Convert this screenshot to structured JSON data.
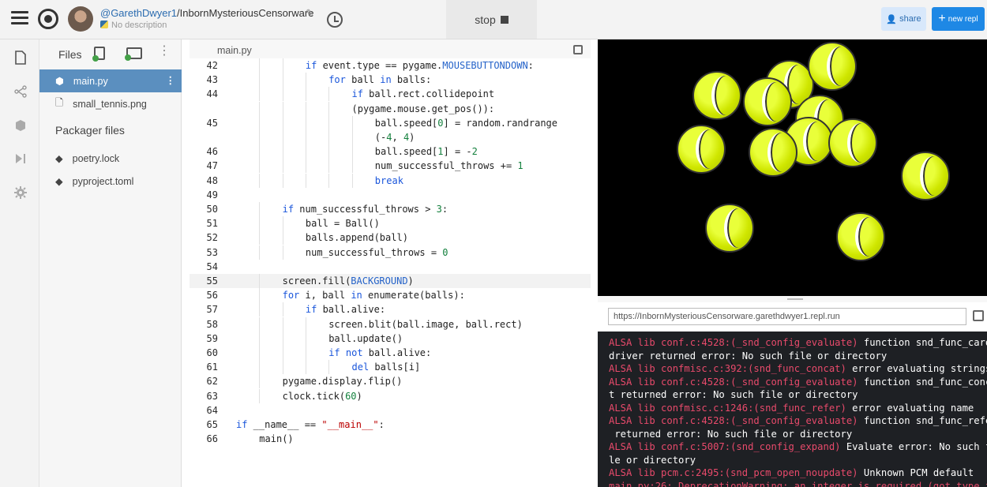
{
  "header": {
    "username": "@GarethDwyer1",
    "repl_name": "/InbornMysteriousCensorware",
    "description": "No description",
    "stop_label": "stop",
    "share_label": "share",
    "new_repl_label": "new repl"
  },
  "files_panel": {
    "title": "Files",
    "files": [
      {
        "name": "main.py",
        "icon": "python-file-icon",
        "active": true
      },
      {
        "name": "small_tennis.png",
        "icon": "file-icon",
        "active": false
      }
    ],
    "packager_title": "Packager files",
    "packager_files": [
      {
        "name": "poetry.lock",
        "icon": "package-icon"
      },
      {
        "name": "pyproject.toml",
        "icon": "package-icon"
      }
    ]
  },
  "editor": {
    "tab": "main.py",
    "current_line": 55,
    "lines": [
      {
        "n": "42",
        "indent": 3,
        "html": "if event.type == pygame.MOUSEBUTTONDOWN:"
      },
      {
        "n": "43",
        "indent": 4,
        "html": "for ball in balls:"
      },
      {
        "n": "44",
        "indent": 5,
        "html": "if ball.rect.collidepoint"
      },
      {
        "n": "",
        "indent": 5,
        "html": "(pygame.mouse.get_pos()):"
      },
      {
        "n": "45",
        "indent": 6,
        "html": "ball.speed[0] = random.randrange"
      },
      {
        "n": "",
        "indent": 6,
        "html": "(-4, 4)"
      },
      {
        "n": "46",
        "indent": 6,
        "html": "ball.speed[1] = -2"
      },
      {
        "n": "47",
        "indent": 6,
        "html": "num_successful_throws += 1"
      },
      {
        "n": "48",
        "indent": 6,
        "html": "break"
      },
      {
        "n": "49",
        "indent": 0,
        "html": ""
      },
      {
        "n": "50",
        "indent": 2,
        "html": "if num_successful_throws > 3:"
      },
      {
        "n": "51",
        "indent": 3,
        "html": "ball = Ball()"
      },
      {
        "n": "52",
        "indent": 3,
        "html": "balls.append(ball)"
      },
      {
        "n": "53",
        "indent": 3,
        "html": "num_successful_throws = 0"
      },
      {
        "n": "54",
        "indent": 0,
        "html": ""
      },
      {
        "n": "55",
        "indent": 2,
        "html": "screen.fill(BACKGROUND)"
      },
      {
        "n": "56",
        "indent": 2,
        "html": "for i, ball in enumerate(balls):"
      },
      {
        "n": "57",
        "indent": 3,
        "html": "if ball.alive:"
      },
      {
        "n": "58",
        "indent": 4,
        "html": "screen.blit(ball.image, ball.rect)"
      },
      {
        "n": "59",
        "indent": 4,
        "html": "ball.update()"
      },
      {
        "n": "60",
        "indent": 4,
        "html": "if not ball.alive:"
      },
      {
        "n": "61",
        "indent": 5,
        "html": "del balls[i]"
      },
      {
        "n": "62",
        "indent": 2,
        "html": "pygame.display.flip()"
      },
      {
        "n": "63",
        "indent": 2,
        "html": "clock.tick(60)"
      },
      {
        "n": "64",
        "indent": 0,
        "html": ""
      },
      {
        "n": "65",
        "indent": 0,
        "html": "if __name__ == \"__main__\":"
      },
      {
        "n": "66",
        "indent": 1,
        "html": "main()"
      }
    ]
  },
  "output": {
    "url": "https://InbornMysteriousCensorware.garethdwyer1.repl.run",
    "console": [
      [
        {
          "c": "pink",
          "t": "ALSA lib conf.c:4528:(_snd_config_evaluate)"
        },
        {
          "c": "",
          "t": " function snd_func_card_"
        }
      ],
      [
        {
          "c": "",
          "t": "driver returned error: No such file or directory"
        }
      ],
      [
        {
          "c": "pink",
          "t": "ALSA lib confmisc.c:392:(snd_func_concat)"
        },
        {
          "c": "",
          "t": " error evaluating strings"
        }
      ],
      [
        {
          "c": "pink",
          "t": "ALSA lib conf.c:4528:(_snd_config_evaluate)"
        },
        {
          "c": "",
          "t": " function snd_func_conca"
        }
      ],
      [
        {
          "c": "",
          "t": "t returned error: No such file or directory"
        }
      ],
      [
        {
          "c": "pink",
          "t": "ALSA lib confmisc.c:1246:(snd_func_refer)"
        },
        {
          "c": "",
          "t": " error evaluating name"
        }
      ],
      [
        {
          "c": "pink",
          "t": "ALSA lib conf.c:4528:(_snd_config_evaluate)"
        },
        {
          "c": "",
          "t": " function snd_func_refer"
        }
      ],
      [
        {
          "c": "",
          "t": " returned error: No such file or directory"
        }
      ],
      [
        {
          "c": "pink",
          "t": "ALSA lib conf.c:5007:(snd_config_expand)"
        },
        {
          "c": "",
          "t": " Evaluate error: No such fi"
        }
      ],
      [
        {
          "c": "",
          "t": "le or directory"
        }
      ],
      [
        {
          "c": "pink",
          "t": "ALSA lib pcm.c:2495:(snd_pcm_open_noupdate)"
        },
        {
          "c": "",
          "t": " Unknown PCM default"
        }
      ],
      [
        {
          "c": "pink",
          "t": "main.py:26: DeprecationWarning: an integer is required (got type fl"
        }
      ]
    ]
  }
}
